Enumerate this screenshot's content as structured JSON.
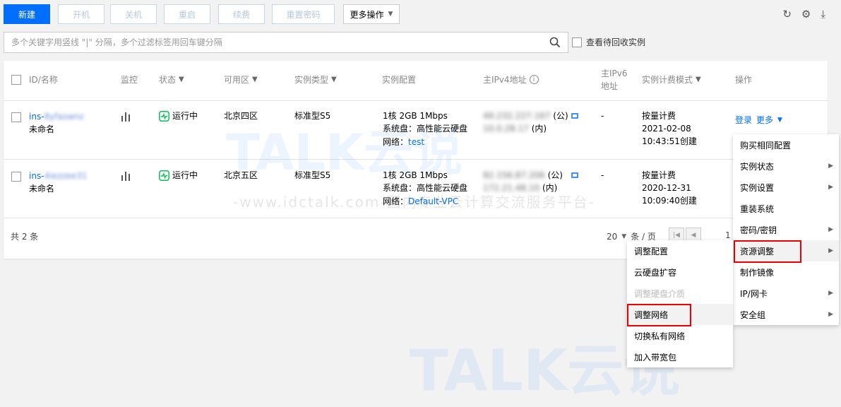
{
  "toolbar": {
    "new": "新建",
    "start": "开机",
    "shutdown": "关机",
    "restart": "重启",
    "renew": "续费",
    "reset_password": "重置密码",
    "more_actions": "更多操作"
  },
  "search": {
    "placeholder": "多个关键字用竖线 \"|\" 分隔，多个过滤标签用回车键分隔",
    "recycle_label": "查看待回收实例"
  },
  "table": {
    "headers": {
      "id_name": "ID/名称",
      "monitor": "监控",
      "status": "状态",
      "zone": "可用区",
      "instance_type": "实例类型",
      "config": "实例配置",
      "ipv4": "主IPv4地址",
      "ipv6_line1": "主IPv6",
      "ipv6_line2": "地址",
      "billing": "实例计费模式",
      "actions": "操作"
    },
    "rows": [
      {
        "id_prefix": "ins-",
        "id_masked": "8yfaswnz",
        "name": "未命名",
        "status": "运行中",
        "zone": "北京四区",
        "type": "标准型S5",
        "config_spec": "1核 2GB 1Mbps",
        "config_disk": "系统盘：高性能云硬盘",
        "config_net_label": "网络：",
        "config_net": "test",
        "public_ip_masked": "49.232.227.167",
        "public_suffix": "(公)",
        "private_ip_masked": "10.0.28.17",
        "private_suffix": "(内)",
        "ipv6": "-",
        "billing_mode": "按量计费",
        "billing_date": "2021-02-08",
        "billing_created": "10:43:51创建",
        "action_login": "登录",
        "action_more": "更多"
      },
      {
        "id_prefix": "ins-",
        "id_masked": "4iezzee31",
        "name": "未命名",
        "status": "运行中",
        "zone": "北京五区",
        "type": "标准型S5",
        "config_spec": "1核 2GB 1Mbps",
        "config_disk": "系统盘：高性能云硬盘",
        "config_net_label": "网络：",
        "config_net": "Default-VPC",
        "public_ip_masked": "82.156.87.206",
        "public_suffix": "(公)",
        "private_ip_masked": "172.21.48.10",
        "private_suffix": "(内)",
        "ipv6": "-",
        "billing_mode": "按量计费",
        "billing_date": "2020-12-31",
        "billing_created": "10:09:40创建"
      }
    ]
  },
  "footer": {
    "total": "共 2 条",
    "page_size": "20",
    "page_size_unit": "条 / 页",
    "page_number": "1"
  },
  "more_menu": [
    {
      "label": "购买相同配置",
      "arrow": false
    },
    {
      "label": "实例状态",
      "arrow": true
    },
    {
      "label": "实例设置",
      "arrow": true
    },
    {
      "label": "重装系统",
      "arrow": false
    },
    {
      "label": "密码/密钥",
      "arrow": true
    },
    {
      "label": "资源调整",
      "arrow": true
    },
    {
      "label": "制作镜像",
      "arrow": false
    },
    {
      "label": "IP/网卡",
      "arrow": true
    },
    {
      "label": "安全组",
      "arrow": true
    }
  ],
  "sub_menu": [
    {
      "label": "调整配置",
      "disabled": false
    },
    {
      "label": "云硬盘扩容",
      "disabled": false
    },
    {
      "label": "调整硬盘介质",
      "disabled": true
    },
    {
      "label": "调整网络",
      "disabled": false
    },
    {
      "label": "切换私有网络",
      "disabled": false
    },
    {
      "label": "加入带宽包",
      "disabled": false
    }
  ],
  "watermark": {
    "logo": "TALK云说",
    "text": "-www.idctalk.com-国内专业云计算交流服务平台-"
  },
  "colors": {
    "primary": "#006eff",
    "running": "#0abf5b",
    "highlight": "#e00000"
  }
}
